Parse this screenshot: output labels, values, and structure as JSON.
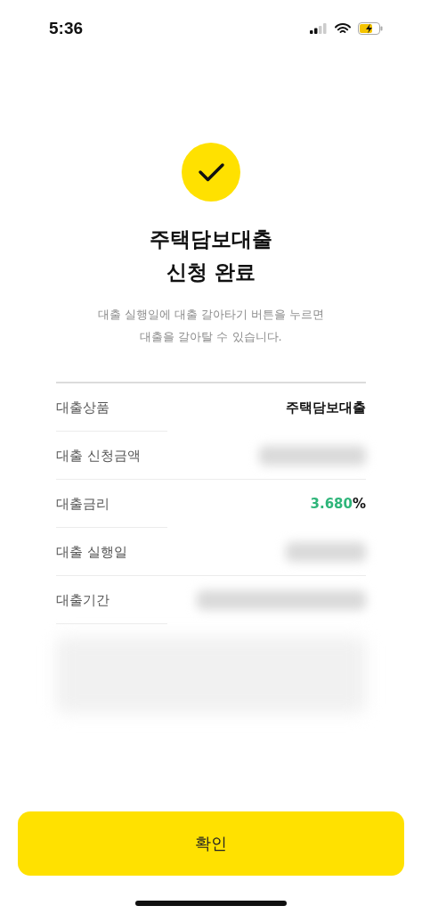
{
  "status_bar": {
    "time": "5:36"
  },
  "title_lines": [
    "주택담보대출",
    "신청 완료"
  ],
  "description_lines": [
    "대출 실행일에 대출 갈아타기 버튼을 누르면",
    "대출을 갈아탈 수 있습니다."
  ],
  "details": [
    {
      "label": "대출상품",
      "kind": "text",
      "value": "주택담보대출"
    },
    {
      "label": "대출 신청금액",
      "kind": "hidden"
    },
    {
      "label": "대출금리",
      "kind": "rate",
      "number": "3.680",
      "unit": "%"
    },
    {
      "label": "대출 실행일",
      "kind": "hidden"
    },
    {
      "label": "대출기간",
      "kind": "hidden"
    }
  ],
  "confirm_button": "확인"
}
